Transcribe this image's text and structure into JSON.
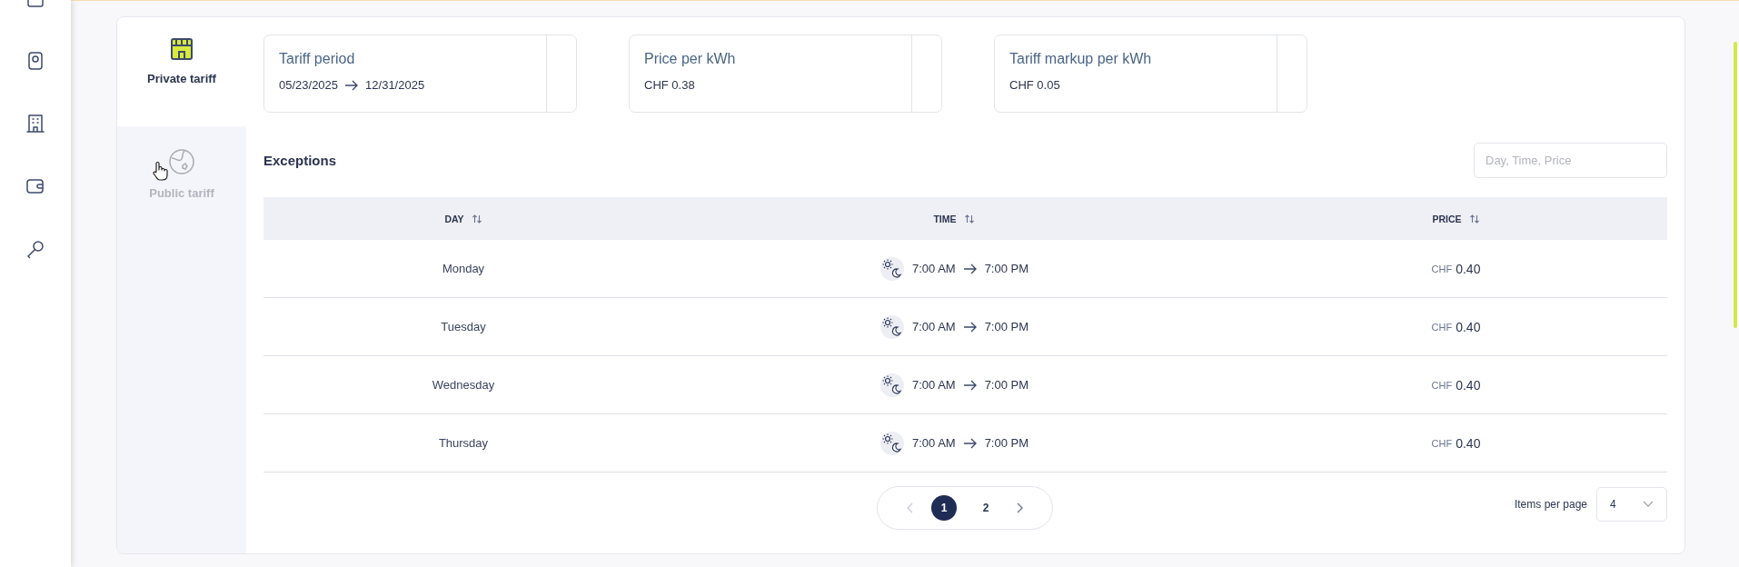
{
  "tabs": [
    {
      "label": "Private tariff",
      "kind": "private",
      "selected": true
    },
    {
      "label": "Public tariff",
      "kind": "public",
      "selected": false
    }
  ],
  "info_cards": [
    {
      "title": "Tariff period",
      "kind": "range",
      "start": "05/23/2025",
      "end": "12/31/2025"
    },
    {
      "title": "Price per kWh",
      "kind": "value",
      "value": "CHF 0.38"
    },
    {
      "title": "Tariff markup per kWh",
      "kind": "value",
      "value": "CHF 0.05"
    }
  ],
  "exceptions": {
    "title": "Exceptions",
    "search": {
      "placeholder": "Day, Time, Price"
    },
    "table": {
      "columns": [
        {
          "label": "DAY"
        },
        {
          "label": "TIME"
        },
        {
          "label": "PRICE"
        }
      ],
      "rows": [
        {
          "day": "Monday",
          "time_start": "7:00 AM",
          "time_end": "7:00 PM",
          "currency": "CHF",
          "price": "0.40"
        },
        {
          "day": "Tuesday",
          "time_start": "7:00 AM",
          "time_end": "7:00 PM",
          "currency": "CHF",
          "price": "0.40"
        },
        {
          "day": "Wednesday",
          "time_start": "7:00 AM",
          "time_end": "7:00 PM",
          "currency": "CHF",
          "price": "0.40"
        },
        {
          "day": "Thursday",
          "time_start": "7:00 AM",
          "time_end": "7:00 PM",
          "currency": "CHF",
          "price": "0.40"
        }
      ]
    },
    "pagination": {
      "prev_disabled": true,
      "next_disabled": false,
      "pages": [
        {
          "label": "1",
          "selected": true
        },
        {
          "label": "2",
          "selected": false
        }
      ]
    },
    "items_per_page": {
      "label": "Items per page",
      "value": "4"
    }
  }
}
